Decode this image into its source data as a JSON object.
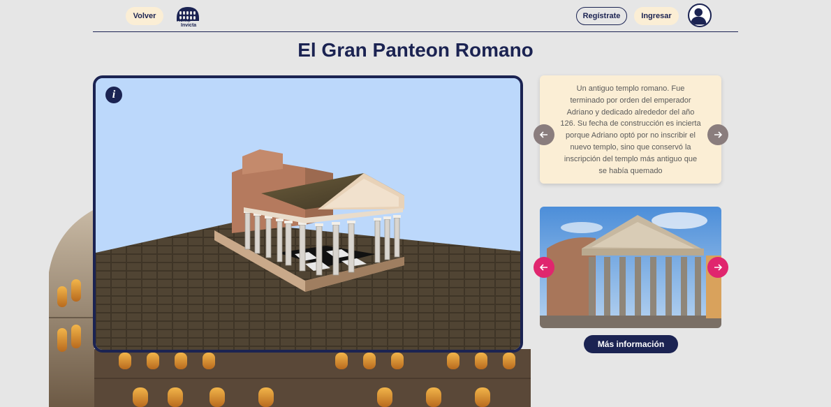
{
  "header": {
    "back_label": "Volver",
    "logo_text_1": "Roma",
    "logo_text_2": "Invicta",
    "register_label": "Regístrate",
    "login_label": "Ingresar"
  },
  "page": {
    "title": "El Gran Panteon Romano"
  },
  "viewer": {
    "info_symbol": "i"
  },
  "description": {
    "text": "Un antiguo templo romano. Fue terminado por orden del emperador Adriano y dedicado alrededor del año 126. Su fecha de construcción es incierta porque Adriano optó por no inscribir el nuevo templo, sino que conservó la inscripción del templo más antiguo que se había quemado"
  },
  "gallery": {
    "more_info_label": "Más información"
  },
  "icons": {
    "prev": "arrow-left-icon",
    "next": "arrow-right-icon",
    "info": "info-icon",
    "user": "user-icon"
  },
  "colors": {
    "navy": "#1b2352",
    "cream": "#fbeed5",
    "pink": "#e0266e",
    "grey_arrow": "#8a7d7d",
    "sky": "#bcd8fb"
  }
}
